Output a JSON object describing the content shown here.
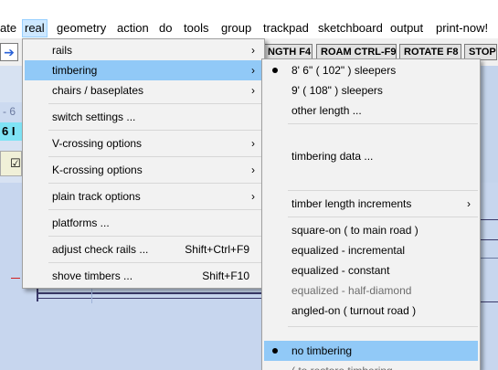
{
  "menubar": {
    "items": [
      {
        "label": "ate"
      },
      {
        "label": "real"
      },
      {
        "label": "geometry"
      },
      {
        "label": "action"
      },
      {
        "label": "do"
      },
      {
        "label": "tools"
      },
      {
        "label": "group"
      },
      {
        "label": "trackpad"
      },
      {
        "label": "sketchboard"
      },
      {
        "label": "output"
      },
      {
        "label": "print-now!"
      }
    ]
  },
  "toolbar": {
    "arrow": "➔",
    "buttons": [
      {
        "label": "NGTH  F4"
      },
      {
        "label": "ROAM  CTRL-F9"
      },
      {
        "label": "ROTATE  F8"
      },
      {
        "label": "STOP"
      }
    ]
  },
  "leftstrip": {
    "text1": "- 6",
    "text2": "6  I",
    "checkbox": "☑"
  },
  "real_menu": {
    "items": [
      {
        "label": "rails",
        "submenu": true
      },
      {
        "label": "timbering",
        "submenu": true,
        "highlighted": true
      },
      {
        "label": "chairs / baseplates",
        "submenu": true
      },
      {
        "label": "switch  settings ..."
      },
      {
        "label": "V-crossing  options",
        "submenu": true
      },
      {
        "label": "K-crossing  options",
        "submenu": true
      },
      {
        "label": "plain  track  options",
        "submenu": true
      },
      {
        "label": "platforms ..."
      },
      {
        "label": "adjust  check  rails ...",
        "shortcut": "Shift+Ctrl+F9"
      },
      {
        "label": "shove  timbers ...",
        "shortcut": "Shift+F10"
      }
    ]
  },
  "timbering_menu": {
    "items": [
      {
        "label": "8' 6\"  ( 102\" )  sleepers",
        "checked": true
      },
      {
        "label": "9'  ( 108\" )  sleepers"
      },
      {
        "label": "other  length ..."
      },
      {
        "label": "timbering  data ..."
      },
      {
        "label": "timber  length  increments",
        "submenu": true
      },
      {
        "label": "square-on  ( to  main  road )"
      },
      {
        "label": "equalized - incremental"
      },
      {
        "label": "equalized - constant"
      },
      {
        "label": "equalized - half-diamond",
        "disabled": true
      },
      {
        "label": "angled-on  ( turnout  road )"
      },
      {
        "label": "no  timbering",
        "checked": true,
        "highlighted": true
      },
      {
        "label": "( to restore timbering"
      }
    ]
  },
  "colors": {
    "highlight": "#91c9f7",
    "menu_bg": "#f2f2f2",
    "canvas_bg": "#c7d6ee"
  }
}
